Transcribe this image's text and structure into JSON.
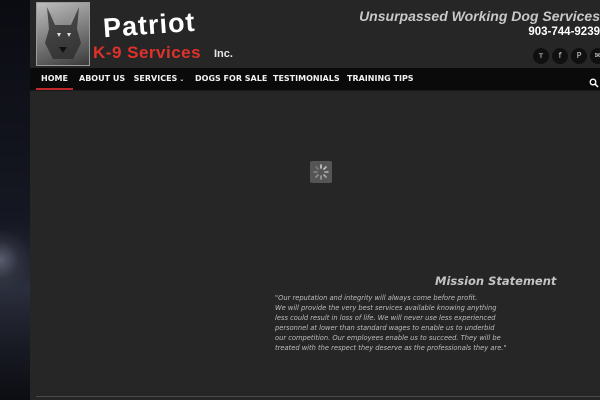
{
  "header": {
    "logo_line1": "Patriot",
    "logo_line2": "K-9 Services",
    "logo_suffix": "Inc.",
    "tagline": "Unsurpassed Working Dog Services",
    "phone": "903-744-9239"
  },
  "social": [
    {
      "icon": "twitter-icon",
      "glyph": "ᴛ"
    },
    {
      "icon": "facebook-icon",
      "glyph": "f"
    },
    {
      "icon": "pinterest-icon",
      "glyph": "P"
    },
    {
      "icon": "email-icon",
      "glyph": "✉"
    }
  ],
  "nav": {
    "items": [
      {
        "label": "HOME",
        "active": true
      },
      {
        "label": "ABOUT US"
      },
      {
        "label": "SERVICES",
        "caret": "⌵"
      },
      {
        "label": "DOGS FOR SALE"
      },
      {
        "label": "TESTIMONIALS"
      },
      {
        "label": "TRAINING TIPS"
      }
    ]
  },
  "mission": {
    "title": "Mission Statement",
    "lines": [
      "\"Our reputation and integrity will always come before profit.",
      "We will provide the very best services available knowing anything",
      "less could result in loss of life. We will never use less experienced",
      "personnel at lower than standard wages to enable us to underbid",
      "our competition. Our employees enable us to succeed. They will be",
      "treated with the respect they deserve as the professionals they are.\""
    ]
  },
  "colors": {
    "accent": "#c0282b",
    "logo_red": "#e0312b",
    "page_bg": "#262626",
    "nav_bg": "#0a0a0a"
  }
}
